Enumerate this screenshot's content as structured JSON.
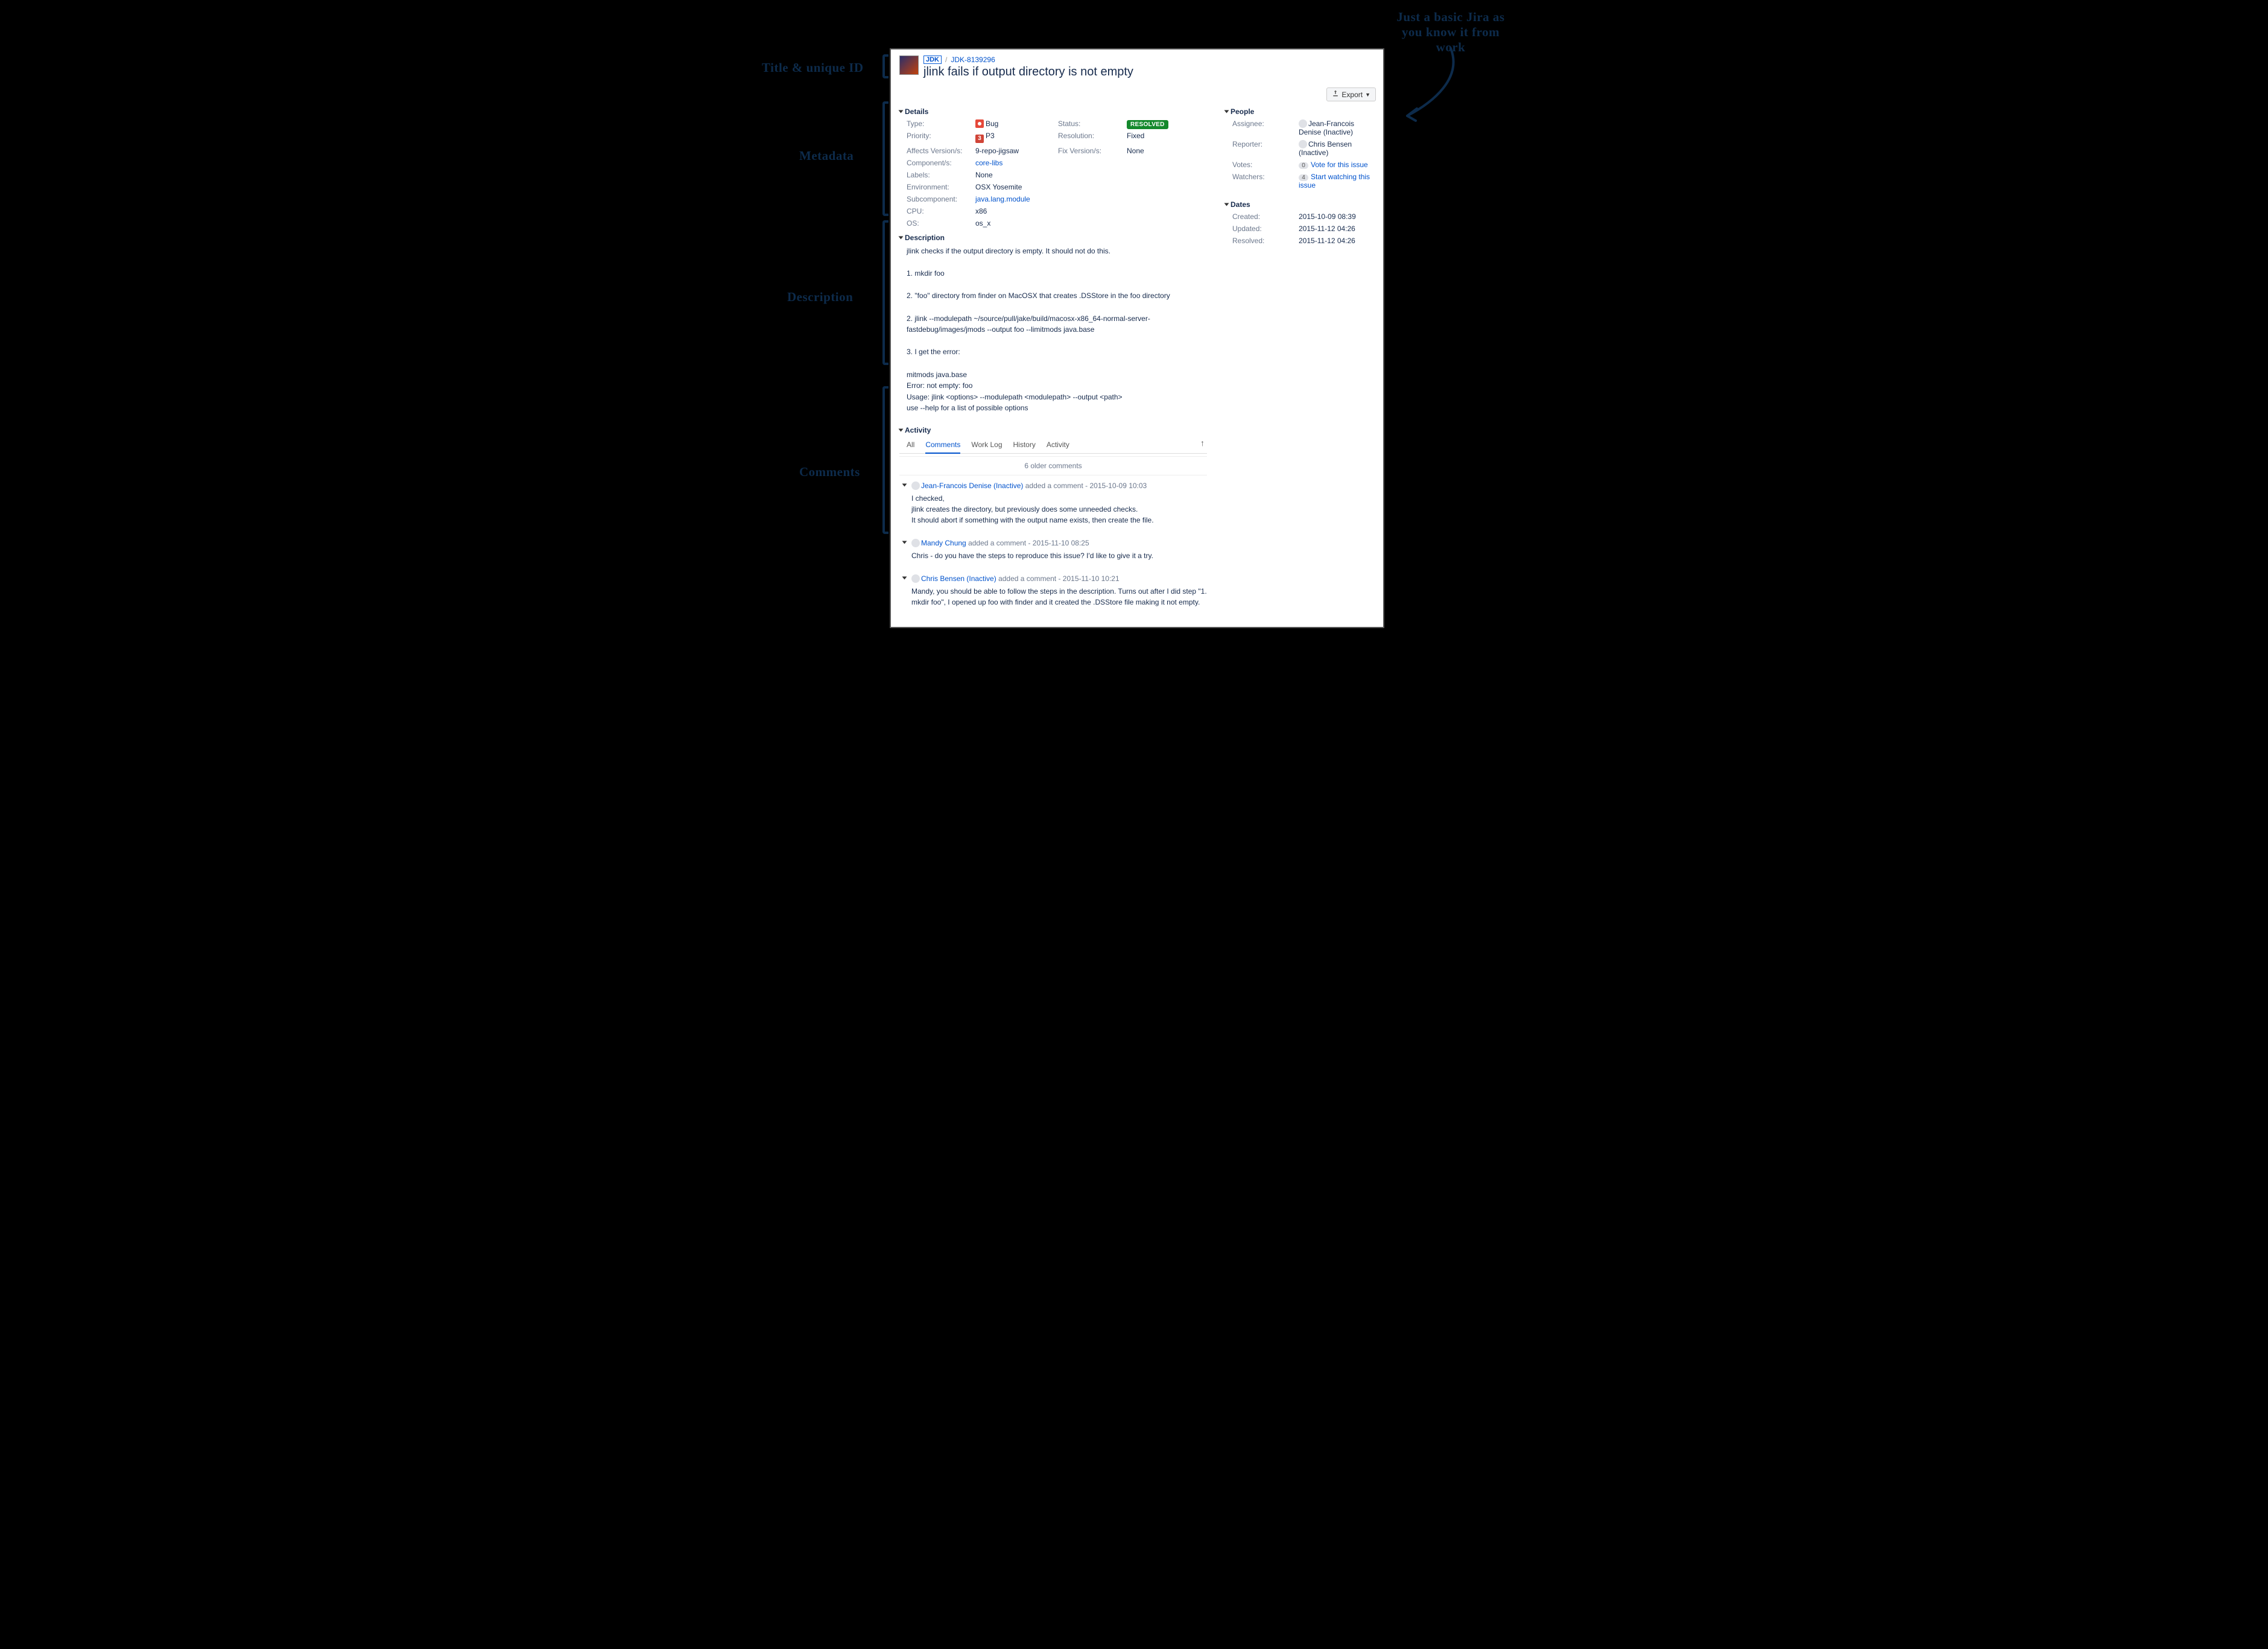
{
  "annotations": {
    "title": "Title & unique ID",
    "metadata": "Metadata",
    "description": "Description",
    "comments": "Comments",
    "top_right": "Just a basic Jira as you know it from work"
  },
  "breadcrumb": {
    "project_badge": "JDK",
    "issue_key": "JDK-8139296"
  },
  "issue_title": "jlink fails if output directory is not empty",
  "export_label": "Export",
  "sections": {
    "details": "Details",
    "description": "Description",
    "activity": "Activity",
    "people": "People",
    "dates": "Dates"
  },
  "details": {
    "labels": {
      "type": "Type:",
      "priority": "Priority:",
      "affects": "Affects Version/s:",
      "components": "Component/s:",
      "labels_l": "Labels:",
      "environment": "Environment:",
      "subcomponent": "Subcomponent:",
      "cpu": "CPU:",
      "os": "OS:",
      "status": "Status:",
      "resolution": "Resolution:",
      "fix_version": "Fix Version/s:"
    },
    "values": {
      "type": "Bug",
      "priority": "P3",
      "priority_icon": "3",
      "affects": "9-repo-jigsaw",
      "components": "core-libs",
      "labels": "None",
      "environment": "OSX Yosemite",
      "subcomponent": "java.lang.module",
      "cpu": "x86",
      "os": "os_x",
      "status": "RESOLVED",
      "resolution": "Fixed",
      "fix_version": "None"
    }
  },
  "description_text": "jlink checks if the output directory is empty. It should not do this.\n\n1. mkdir foo\n\n2. \"foo\" directory from finder on MacOSX that creates .DSStore in the foo directory\n\n2. jlink --modulepath ~/source/pull/jake/build/macosx-x86_64-normal-server-fastdebug/images/jmods --output foo --limitmods java.base\n\n3. I get the error:\n\nmitmods java.base\nError: not empty: foo\nUsage: jlink <options> --modulepath <modulepath> --output <path>\nuse --help for a list of possible options",
  "activity": {
    "tabs": [
      "All",
      "Comments",
      "Work Log",
      "History",
      "Activity"
    ],
    "active_tab": "Comments",
    "older": "6 older comments",
    "added_text": "added a comment -",
    "comments": [
      {
        "author": "Jean-Francois Denise (Inactive)",
        "when": "2015-10-09 10:03",
        "body": "I checked,\njlink creates the directory, but previously does some unneeded checks.\nIt should abort if something with the output name exists, then create the file."
      },
      {
        "author": "Mandy Chung",
        "when": "2015-11-10 08:25",
        "body": "Chris - do you have the steps to reproduce this issue? I'd like to give it a try."
      },
      {
        "author": "Chris Bensen (Inactive)",
        "when": "2015-11-10 10:21",
        "body": "Mandy, you should be able to follow the steps in the description. Turns out after I did step \"1. mkdir foo\", I opened up foo with finder and it created the .DSStore file making it not empty."
      }
    ]
  },
  "people": {
    "labels": {
      "assignee": "Assignee:",
      "reporter": "Reporter:",
      "votes": "Votes:",
      "watchers": "Watchers:"
    },
    "assignee": "Jean-Francois Denise (Inactive)",
    "reporter": "Chris Bensen (Inactive)",
    "votes_count": "0",
    "votes_text": "Vote for this issue",
    "watchers_count": "4",
    "watchers_text": "Start watching this issue"
  },
  "dates": {
    "labels": {
      "created": "Created:",
      "updated": "Updated:",
      "resolved": "Resolved:"
    },
    "created": "2015-10-09 08:39",
    "updated": "2015-11-12 04:26",
    "resolved": "2015-11-12 04:26"
  }
}
